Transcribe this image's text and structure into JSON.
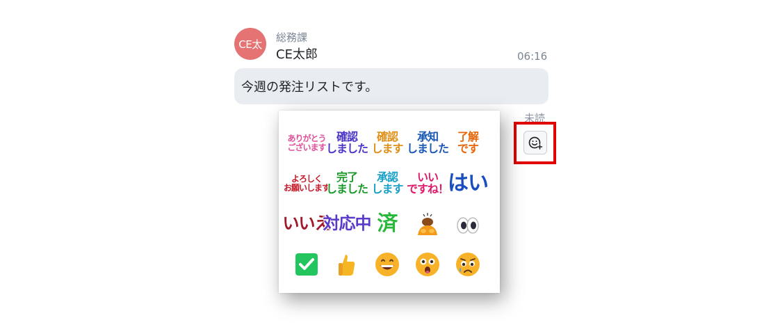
{
  "message": {
    "avatar_text": "CE太",
    "department": "総務課",
    "sender": "CE太郎",
    "time": "06:16",
    "text": "今週の発注リストです。",
    "read_status": "未読"
  },
  "reaction_button": {
    "icon": "add-reaction-icon"
  },
  "stickers": [
    {
      "name": "sticker-arigatou",
      "lines": [
        "ありがとう",
        "ございます"
      ],
      "color": "#e0509a",
      "size": "s2"
    },
    {
      "name": "sticker-kakunin-shimashita",
      "lines": [
        "確認",
        "しました"
      ],
      "color": "#4a36c8",
      "size": "s2b"
    },
    {
      "name": "sticker-kakunin-shimasu",
      "lines": [
        "確認",
        "します"
      ],
      "color": "#e0901a",
      "size": "s2b"
    },
    {
      "name": "sticker-shouchi-shimashita",
      "lines": [
        "承知",
        "しました"
      ],
      "color": "#1a58b8",
      "size": "s2b"
    },
    {
      "name": "sticker-ryoukai-desu",
      "lines": [
        "了解",
        "です"
      ],
      "color": "#e8660a",
      "size": "s2b"
    },
    {
      "name": "sticker-yoroshiku",
      "lines": [
        "よろしく",
        "お願いします"
      ],
      "color": "#c41a2a",
      "size": "s2"
    },
    {
      "name": "sticker-kanryou-shimashita",
      "lines": [
        "完了",
        "しました"
      ],
      "color": "#1a9a2a",
      "size": "s2b"
    },
    {
      "name": "sticker-shounin-shimasu",
      "lines": [
        "承認",
        "します"
      ],
      "color": "#1aa0c8",
      "size": "s2b"
    },
    {
      "name": "sticker-ii-desu-ne",
      "lines": [
        "いい",
        "ですね！"
      ],
      "color": "#e0186a",
      "size": "s2b"
    },
    {
      "name": "sticker-hai",
      "lines": [
        "はい"
      ],
      "color": "#1a4ec0",
      "size": "s1b"
    },
    {
      "name": "sticker-iie",
      "lines": [
        "いいえ"
      ],
      "color": "#a01a2a",
      "size": "s1"
    },
    {
      "name": "sticker-taiouchuu",
      "lines": [
        "対応中"
      ],
      "color": "#5a3ac8",
      "size": "s1"
    },
    {
      "name": "sticker-zumi",
      "lines": [
        "済"
      ],
      "color": "#2ab83a",
      "size": "s1b"
    }
  ],
  "emojis": [
    {
      "name": "bowing-person-emoji",
      "icon": "bowing-person"
    },
    {
      "name": "eyes-emoji",
      "icon": "eyes"
    },
    {
      "name": "check-mark-button-emoji",
      "icon": "check-mark-button"
    },
    {
      "name": "thumbs-up-emoji",
      "icon": "thumbs-up"
    },
    {
      "name": "grinning-face-emoji",
      "icon": "grinning-face"
    },
    {
      "name": "astonished-face-emoji",
      "icon": "astonished-face"
    },
    {
      "name": "sad-relieved-face-emoji",
      "icon": "sad-relieved-face"
    }
  ]
}
